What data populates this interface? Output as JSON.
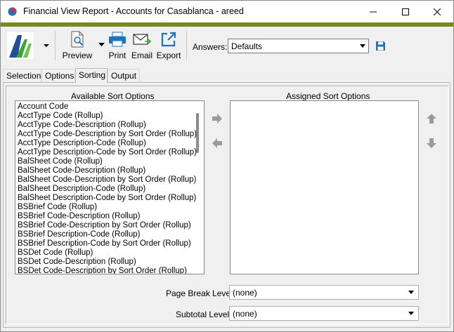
{
  "window": {
    "title": "Financial View Report - Accounts for Casablanca - areed"
  },
  "toolbar": {
    "buttons": [
      {
        "label": "Preview",
        "icon": "preview-icon"
      },
      {
        "label": "Print",
        "icon": "printer-icon"
      },
      {
        "label": "Email",
        "icon": "email-icon"
      },
      {
        "label": "Export",
        "icon": "export-icon"
      }
    ],
    "answers_label": "Answers:",
    "answers_value": "Defaults"
  },
  "tabs": [
    {
      "label": "Selection",
      "active": false
    },
    {
      "label": "Options",
      "active": false
    },
    {
      "label": "Sorting",
      "active": true
    },
    {
      "label": "Output",
      "active": false
    }
  ],
  "sorting": {
    "available_label": "Available Sort Options",
    "assigned_label": "Assigned Sort Options",
    "available_options": [
      "Account Code",
      "AcctType Code (Rollup)",
      "AcctType Code-Description (Rollup)",
      "AcctType Code-Description by Sort Order (Rollup)",
      "AcctType Description-Code (Rollup)",
      "AcctType Description-Code by Sort Order (Rollup)",
      "BalSheet Code (Rollup)",
      "BalSheet Code-Description (Rollup)",
      "BalSheet Code-Description by Sort Order (Rollup)",
      "BalSheet Description-Code (Rollup)",
      "BalSheet Description-Code by Sort Order (Rollup)",
      "BSBrief Code (Rollup)",
      "BSBrief Code-Description (Rollup)",
      "BSBrief Code-Description by Sort Order (Rollup)",
      "BSBrief Description-Code (Rollup)",
      "BSBrief Description-Code by Sort Order (Rollup)",
      "BSDet Code (Rollup)",
      "BSDet Code-Description (Rollup)",
      "BSDet Code-Description by Sort Order (Rollup)"
    ],
    "assigned_options": [],
    "page_break_label": "Page Break Level:",
    "page_break_value": "(none)",
    "subtotal_label": "Subtotal Level:",
    "subtotal_value": "(none)"
  },
  "colors": {
    "accent_bar": "#7a8a17",
    "toolbar_icon_blue": "#1e73be",
    "arrow_gray": "#9a9a9a"
  }
}
